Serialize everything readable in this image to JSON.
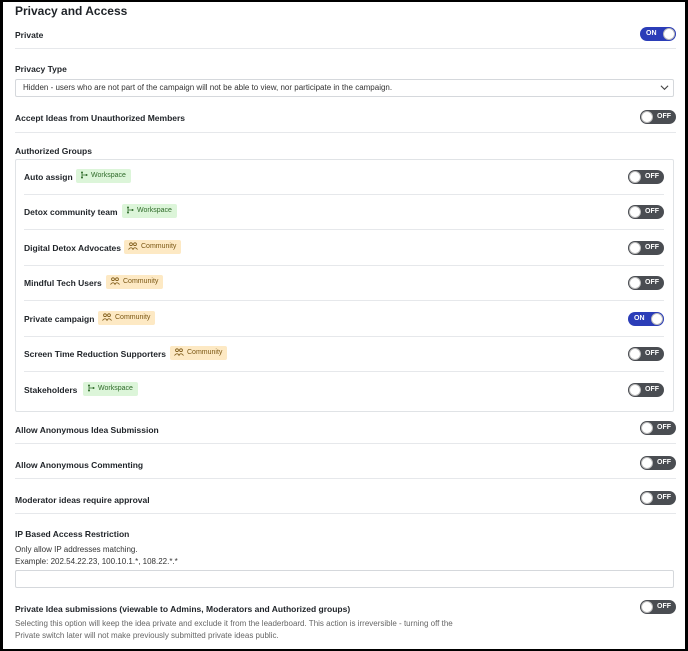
{
  "section": {
    "title": "Privacy and Access"
  },
  "private": {
    "label": "Private",
    "toggle": "ON"
  },
  "privacy_type": {
    "label": "Privacy Type",
    "selected": "Hidden - users who are not part of the campaign will not be able to view, nor participate in the campaign."
  },
  "accept_unauthorized": {
    "label": "Accept Ideas from Unauthorized Members",
    "toggle": "OFF"
  },
  "authorized_groups": {
    "label": "Authorized Groups",
    "items": [
      {
        "name": "Auto assign",
        "badge": "Workspace",
        "badge_type": "workspace",
        "toggle": "OFF"
      },
      {
        "name": "Detox community team",
        "badge": "Workspace",
        "badge_type": "workspace",
        "toggle": "OFF"
      },
      {
        "name": "Digital Detox Advocates",
        "badge": "Community",
        "badge_type": "community",
        "toggle": "OFF"
      },
      {
        "name": "Mindful Tech Users",
        "badge": "Community",
        "badge_type": "community",
        "toggle": "OFF"
      },
      {
        "name": "Private campaign",
        "badge": "Community",
        "badge_type": "community",
        "toggle": "ON"
      },
      {
        "name": "Screen Time Reduction Supporters",
        "badge": "Community",
        "badge_type": "community",
        "toggle": "OFF"
      },
      {
        "name": "Stakeholders",
        "badge": "Workspace",
        "badge_type": "workspace",
        "toggle": "OFF"
      }
    ]
  },
  "anon_submission": {
    "label": "Allow Anonymous Idea Submission",
    "toggle": "OFF"
  },
  "anon_commenting": {
    "label": "Allow Anonymous Commenting",
    "toggle": "OFF"
  },
  "moderator_approval": {
    "label": "Moderator ideas require approval",
    "toggle": "OFF"
  },
  "ip_restriction": {
    "label": "IP Based Access Restriction",
    "help_line1": "Only allow IP addresses matching.",
    "help_line2": "Example: 202.54.22.23, 100.10.1.*, 108.22.*.*",
    "value": ""
  },
  "private_submissions": {
    "label": "Private Idea submissions (viewable to Admins, Moderators and Authorized groups)",
    "toggle": "OFF",
    "description_line1": "Selecting this option will keep the idea private and exclude it from the leaderboard. This action is irreversible - turning off the",
    "description_line2": "Private switch later will not make previously submitted private ideas public."
  },
  "colors": {
    "toggle_on": "#2b3db8",
    "toggle_off": "#4a4d52",
    "workspace_badge": "#dcf5d9",
    "community_badge": "#fde9c4"
  }
}
